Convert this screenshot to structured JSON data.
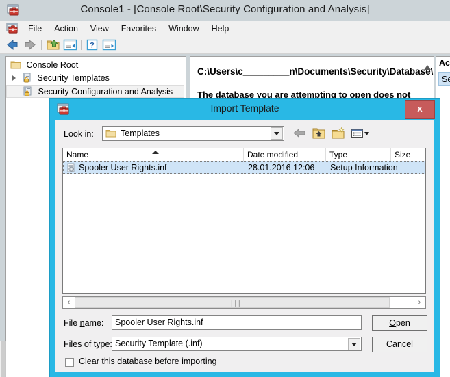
{
  "window": {
    "title": "Console1 - [Console Root\\Security Configuration and Analysis]",
    "icon": "mmc-console-icon"
  },
  "menubar": {
    "icon": "mmc-console-icon",
    "items": [
      {
        "label": "File"
      },
      {
        "label": "Action"
      },
      {
        "label": "View"
      },
      {
        "label": "Favorites"
      },
      {
        "label": "Window"
      },
      {
        "label": "Help"
      }
    ]
  },
  "toolbar": {
    "buttons": [
      {
        "name": "back-button",
        "icon": "left-arrow-icon"
      },
      {
        "name": "forward-button",
        "icon": "right-arrow-icon"
      },
      {
        "name": "up-one-level-button",
        "icon": "folder-up-icon"
      },
      {
        "name": "show-hide-console-tree-button",
        "icon": "console-tree-icon"
      },
      {
        "name": "help-button",
        "icon": "question-mark-icon"
      },
      {
        "name": "show-hide-action-pane-button",
        "icon": "action-pane-icon"
      }
    ]
  },
  "tree": {
    "items": [
      {
        "label": "Console Root",
        "icon": "folder-icon",
        "indent": 0,
        "expander": false,
        "selected": false
      },
      {
        "label": "Security Templates",
        "icon": "security-template-icon",
        "indent": 1,
        "expander": true,
        "selected": false
      },
      {
        "label": "Security Configuration and Analysis",
        "icon": "security-template-icon",
        "indent": 1,
        "expander": false,
        "selected": true
      }
    ]
  },
  "result_pane": {
    "line1": "C:\\Users\\c_________n\\Documents\\Security\\Database\\s",
    "line2": "The database you are attempting to open does not"
  },
  "actions_pane": {
    "header": "Act",
    "item": "Se"
  },
  "dialog": {
    "title": "Import Template",
    "icon": "mmc-console-icon",
    "close_label": "x",
    "lookin": {
      "label": "Look in:",
      "value": "Templates",
      "folder_icon": "folder-icon"
    },
    "nav_buttons": [
      {
        "name": "back-nav-button",
        "icon": "back-arrow-icon"
      },
      {
        "name": "up-one-level-button",
        "icon": "folder-up-icon"
      },
      {
        "name": "new-folder-button",
        "icon": "new-folder-icon"
      },
      {
        "name": "views-button",
        "icon": "views-icon"
      }
    ],
    "columns": [
      {
        "label": "Name",
        "sorted": true
      },
      {
        "label": "Date modified",
        "sorted": false
      },
      {
        "label": "Type",
        "sorted": false
      },
      {
        "label": "Size",
        "sorted": false
      }
    ],
    "files": [
      {
        "name": "Spooler User Rights.inf",
        "date_modified": "28.01.2016 12:06",
        "type": "Setup Information",
        "size": "",
        "icon": "inf-file-icon",
        "selected": true
      }
    ],
    "scrollbar": {
      "left_arrow": "‹",
      "right_arrow": "›",
      "grip": "∣∣∣"
    },
    "filename": {
      "label_pre": "File ",
      "label_accel": "n",
      "label_post": "ame:",
      "value": "Spooler User Rights.inf"
    },
    "filetype": {
      "label_pre": "Files of ",
      "label_accel": "t",
      "label_post": "ype:",
      "value": "Security Template (.inf)"
    },
    "buttons": {
      "open_pre": "",
      "open_accel": "O",
      "open_post": "pen",
      "cancel": "Cancel"
    },
    "checkbox": {
      "label_pre": "",
      "label_accel": "C",
      "label_post": "lear this database before importing",
      "checked": false
    }
  },
  "colors": {
    "window_chrome": "#ccd4d8",
    "dialog_accent": "#29b8e5",
    "selection": "#cfe4f7",
    "close_button": "#c75b5b"
  }
}
